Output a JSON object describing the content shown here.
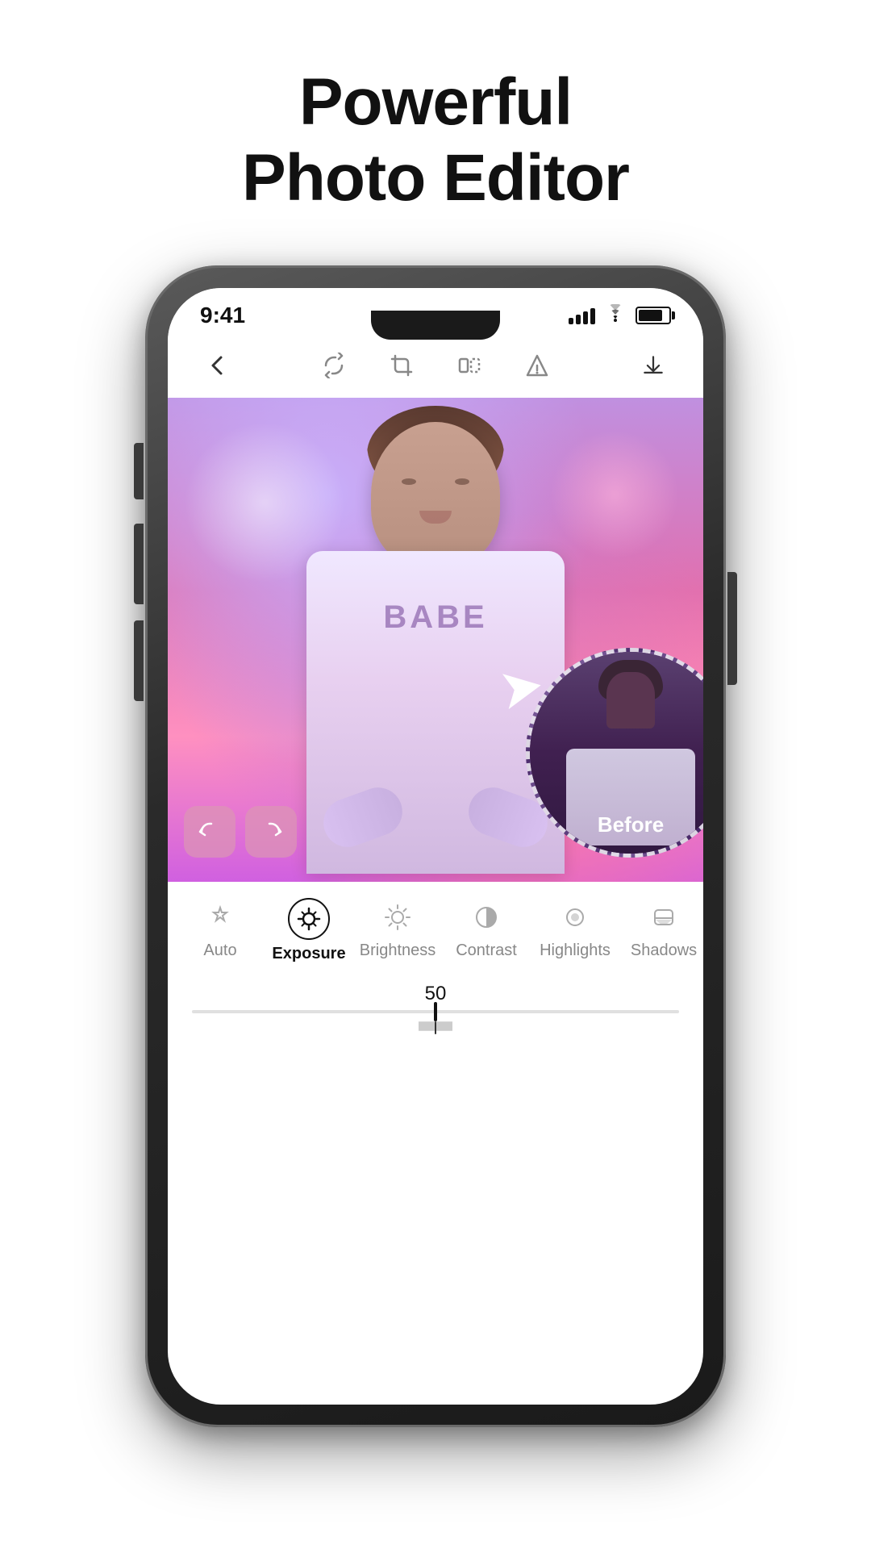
{
  "page": {
    "title_line1": "Powerful",
    "title_line2": "Photo Editor"
  },
  "status_bar": {
    "time": "9:41",
    "signal_bars": [
      8,
      12,
      16,
      20
    ],
    "battery_label": "battery"
  },
  "toolbar": {
    "back_label": "back",
    "rotate_label": "rotate",
    "crop_label": "crop",
    "flip_label": "flip",
    "adjust_label": "adjust",
    "download_label": "download"
  },
  "photo": {
    "shirt_text": "BABE",
    "before_label": "Before"
  },
  "editor": {
    "undo_label": "undo",
    "redo_label": "redo",
    "tools": [
      {
        "id": "auto",
        "label": "Auto",
        "active": false
      },
      {
        "id": "exposure",
        "label": "Exposure",
        "active": true
      },
      {
        "id": "brightness",
        "label": "Brightness",
        "active": false
      },
      {
        "id": "contrast",
        "label": "Contrast",
        "active": false
      },
      {
        "id": "highlights",
        "label": "Highlights",
        "active": false
      },
      {
        "id": "shadows",
        "label": "Shadows",
        "active": false
      }
    ],
    "slider_value": "50"
  }
}
